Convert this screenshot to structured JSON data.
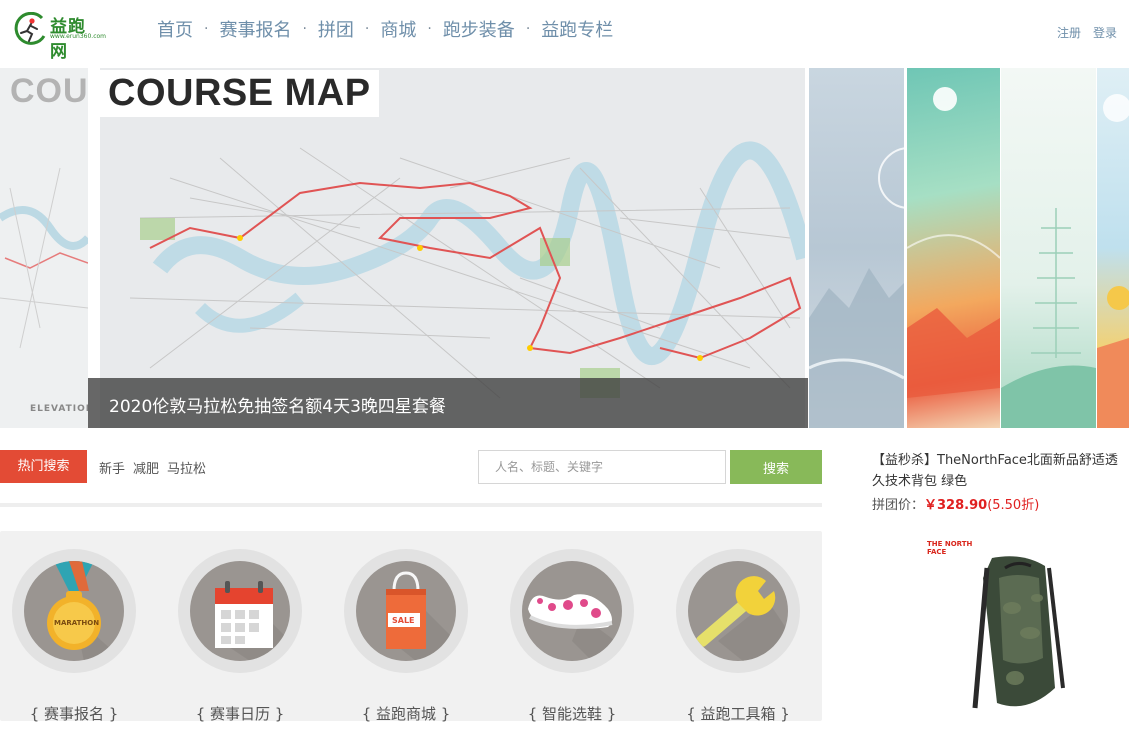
{
  "header": {
    "logo_name": "益跑网",
    "logo_url": "www.erun360.com",
    "nav": [
      "首页",
      "赛事报名",
      "拼团",
      "商城",
      "跑步装备",
      "益跑专栏"
    ],
    "nav_separator": "·",
    "register": "注册",
    "login": "登录"
  },
  "banner": {
    "left_slide_text": "COU",
    "left_slide_label": "ELEVATION",
    "main_title": "COURSE MAP",
    "caption": "2020伦敦马拉松免抽签名额4天3晚四星套餐"
  },
  "search": {
    "hot_label": "热门搜索",
    "hot_keywords": [
      "新手",
      "减肥",
      "马拉松"
    ],
    "placeholder": "人名、标题、关键字",
    "button_label": "搜索"
  },
  "shortcuts": [
    {
      "label": "{ 赛事报名 }",
      "icon": "marathon-medal-icon"
    },
    {
      "label": "{ 赛事日历 }",
      "icon": "calendar-icon"
    },
    {
      "label": "{ 益跑商城 }",
      "icon": "shopping-bag-icon"
    },
    {
      "label": "{ 智能选鞋 }",
      "icon": "running-shoe-icon"
    },
    {
      "label": "{ 益跑工具箱 }",
      "icon": "wrench-icon"
    }
  ],
  "medal_text": "MARATHON",
  "bag_text": "SALE",
  "promo": {
    "title": "【益秒杀】TheNorthFace北面新品舒适透久技术背包 绿色",
    "price_label": "拼团价：",
    "price": "￥328.90",
    "discount": "(5.50折)",
    "brand_text": "THE NORTH FACE"
  },
  "colors": {
    "brand_green": "#2e8b2e",
    "nav_text": "#6f8faa",
    "hot_tag_red": "#e34b35",
    "search_green": "#88b959",
    "price_red": "#e02020"
  }
}
